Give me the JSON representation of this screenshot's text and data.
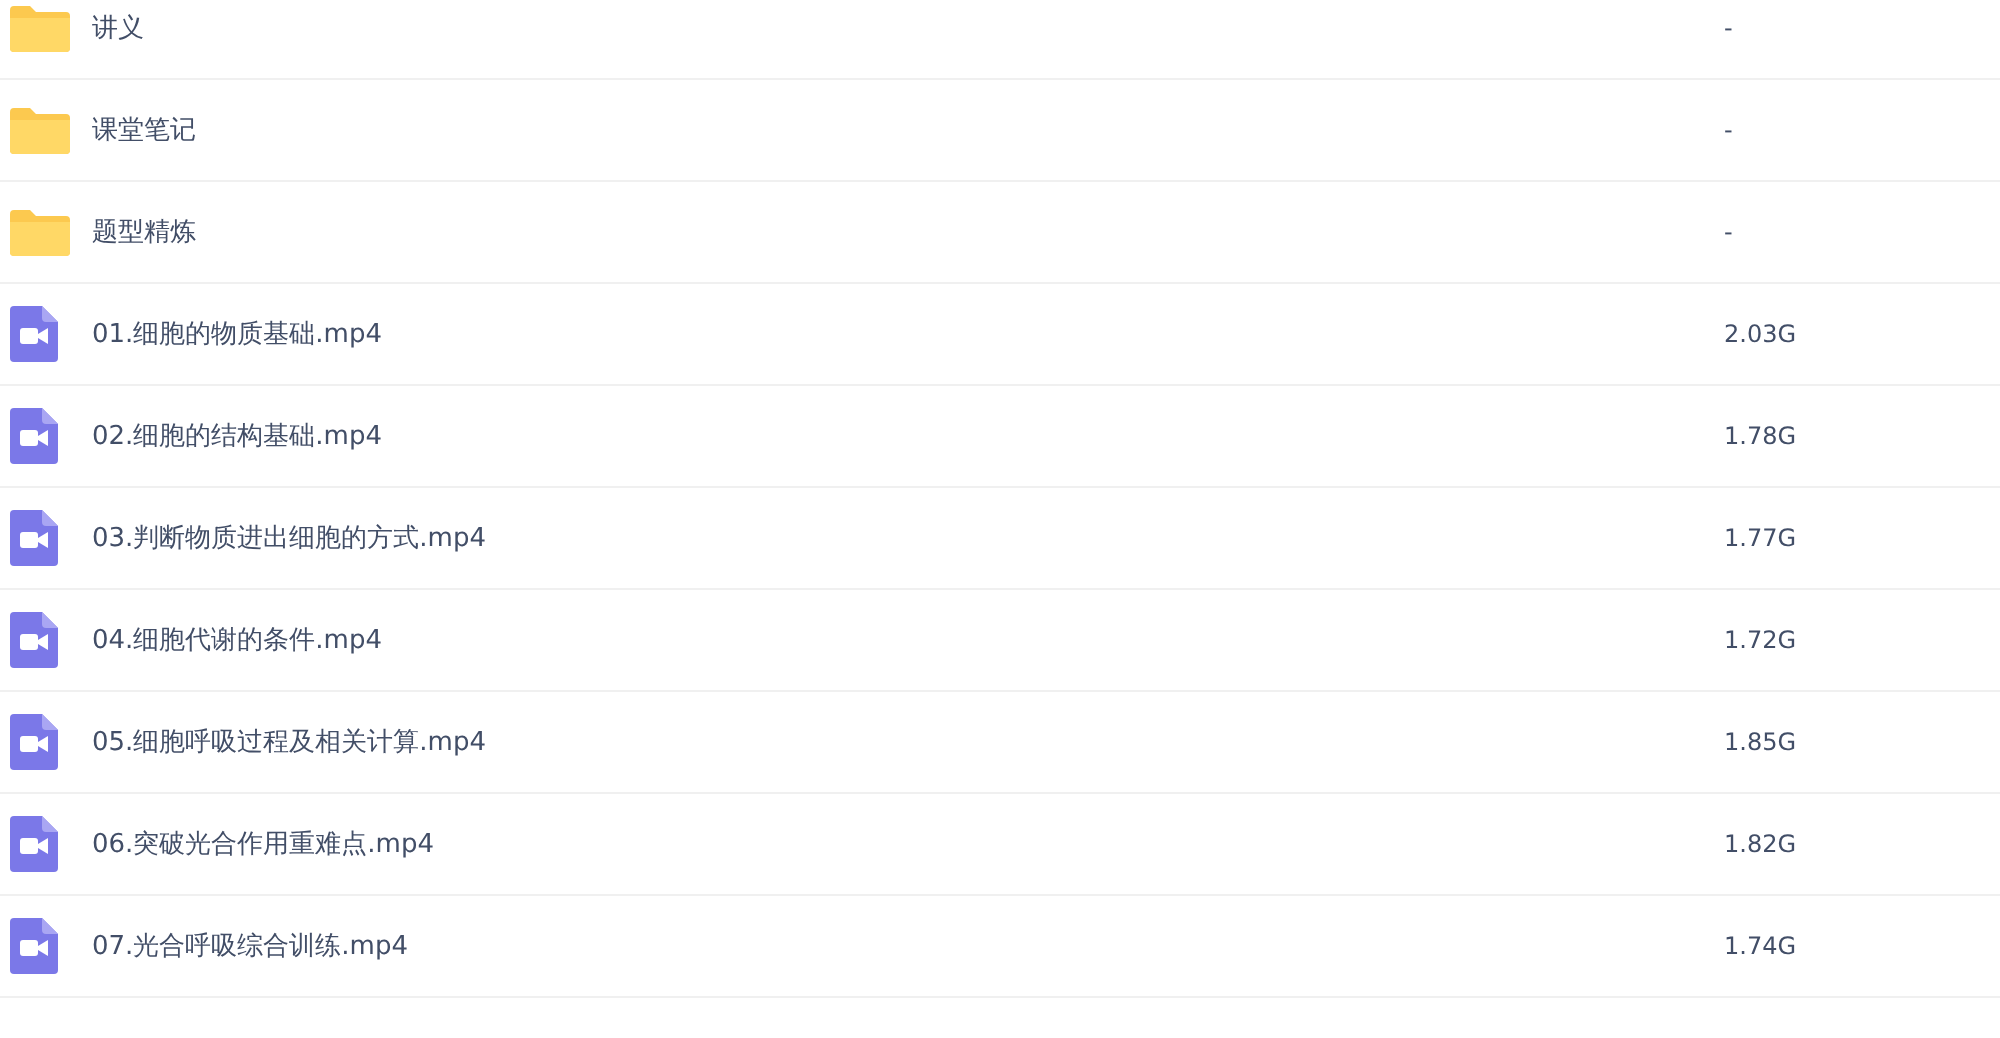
{
  "files": [
    {
      "kind": "folder",
      "name": "讲义",
      "size": "-"
    },
    {
      "kind": "folder",
      "name": "课堂笔记",
      "size": "-"
    },
    {
      "kind": "folder",
      "name": "题型精炼",
      "size": "-"
    },
    {
      "kind": "video",
      "name": "01.细胞的物质基础.mp4",
      "size": "2.03G"
    },
    {
      "kind": "video",
      "name": "02.细胞的结构基础.mp4",
      "size": "1.78G"
    },
    {
      "kind": "video",
      "name": "03.判断物质进出细胞的方式.mp4",
      "size": "1.77G"
    },
    {
      "kind": "video",
      "name": "04.细胞代谢的条件.mp4",
      "size": "1.72G"
    },
    {
      "kind": "video",
      "name": "05.细胞呼吸过程及相关计算.mp4",
      "size": "1.85G"
    },
    {
      "kind": "video",
      "name": "06.突破光合作用重难点.mp4",
      "size": "1.82G"
    },
    {
      "kind": "video",
      "name": "07.光合呼吸综合训练.mp4",
      "size": "1.74G"
    }
  ]
}
